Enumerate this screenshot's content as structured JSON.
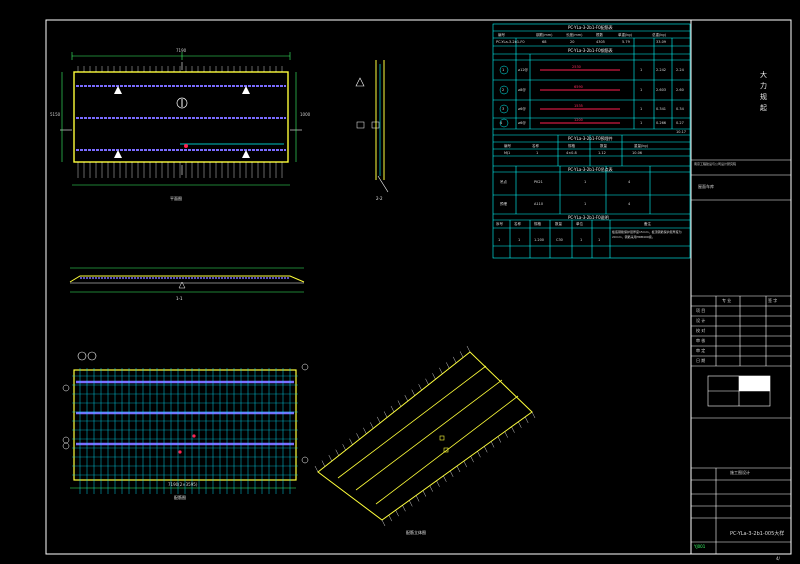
{
  "titleblock": {
    "company": "大\n力\n规\n起",
    "owner_note": "南京工程建设与公司设计研究院",
    "project_name": "屋面车库",
    "sheet_code": "PC-YLa-3-2b1-005大样",
    "sheet_short": "YJ001",
    "page": "4/",
    "rows": [
      "项 目",
      "设 计",
      "校 对",
      "审 核",
      "审 定",
      "日 期"
    ],
    "header_left": "专 业",
    "header_right": "签 字",
    "plan_name": "施工图设计"
  },
  "drawing_labels": {
    "plan_top": "平面图",
    "section_11": "1-1",
    "section_22": "2-2",
    "plan_bottom": "配筋图",
    "axon": "配筋立体图",
    "dim_top_total": "7190",
    "dim_left": "5150",
    "dim_right": "1000",
    "dim_bottom_total": "7190(2×3595)"
  },
  "tables": {
    "t1_title": "PC-YLa-3-2b1-F0配筋表",
    "t1_headers": [
      "编号",
      "钢筋(mm)",
      "长度(mm)",
      "根数",
      "单重(kg)",
      "总重(kg)"
    ],
    "t1_row": [
      "PC-YLa-3-2b1-F0",
      "68",
      "20",
      "4305",
      "5.79",
      "33.09"
    ],
    "t2_title": "PC-YLa-3-2b1-F0钢筋表",
    "t2_rows": [
      {
        "id": "1",
        "dia": "⌀12@",
        "len": "2530",
        "n": "1",
        "w": "2.242",
        "t": "2.24"
      },
      {
        "id": "2",
        "dia": "⌀8@",
        "len": "6590",
        "n": "1",
        "w": "2.603",
        "t": "2.60"
      },
      {
        "id": "3",
        "dia": "⌀6@",
        "len": "1535",
        "n": "1",
        "w": "0.341",
        "t": "0.34"
      },
      {
        "id": "4",
        "dia": "⌀6@",
        "len": "1200",
        "n": "1",
        "w": "0.266",
        "t": "0.27"
      }
    ],
    "t2_total": "10.17",
    "t3_title": "PC-YLa-3-2b1-F0预埋件",
    "t3_headers": [
      "编号",
      "名称",
      "规格",
      "数量",
      "重量(kg)"
    ],
    "t3_row": [
      "MJ1",
      "1",
      "4×0.8",
      "1.12",
      "10.06"
    ],
    "t4_title": "PC-YLa-3-2b1-F0吊点表",
    "t4_rows": [
      [
        "吊点",
        "PK21",
        "1",
        "4"
      ],
      [
        "预埋",
        "A110",
        "1",
        "4"
      ]
    ],
    "t5_title": "PC-YLa-3-2b1-F0说明",
    "t5_headers": [
      "序号",
      "名称",
      "规格",
      "数量",
      "单位",
      "备注"
    ],
    "t5_row": [
      "1",
      "1",
      "1.200",
      "C30",
      "1",
      "1"
    ],
    "t5_note": "板底钢筋保护层厚度15mm，板顶钢筋保护层厚度为20mm，钢筋采用HRB400级。"
  },
  "colors": {
    "frame": "#ffffff",
    "slab": "#ffff3a",
    "rebar_main": "#7a6cff",
    "rebar_cyan": "#00ffff",
    "marker_red": "#ff2050",
    "dim_green": "#3cff6a"
  },
  "icons": [
    "north-arrow-icon",
    "triangle-marker-icon",
    "section-bubble-icon"
  ]
}
